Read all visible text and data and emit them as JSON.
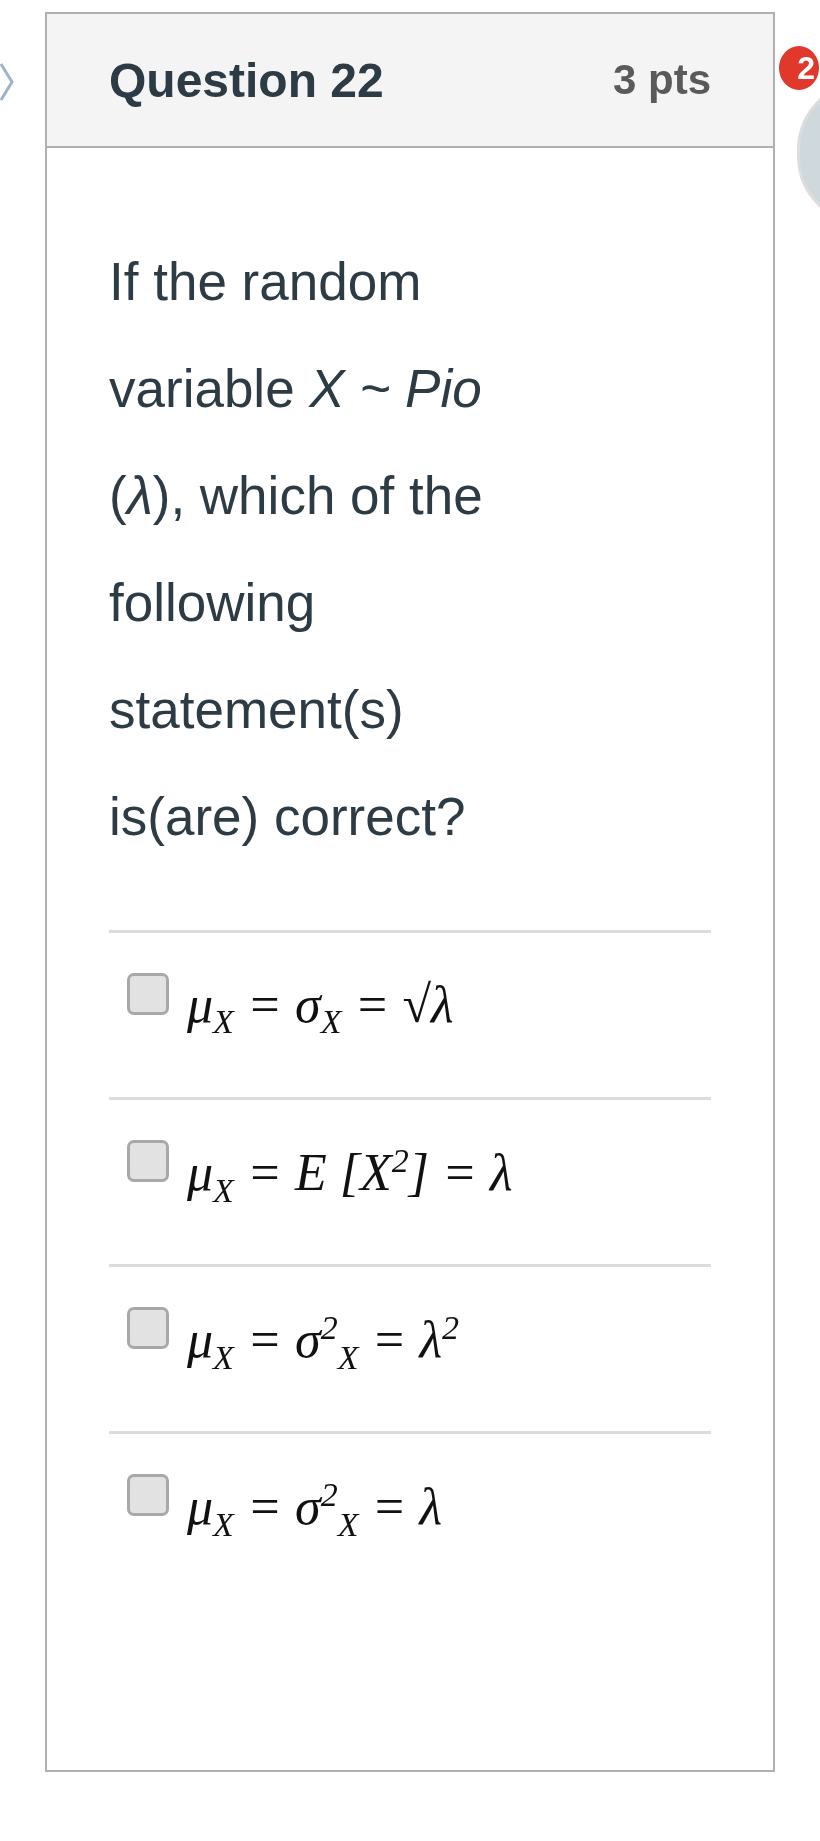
{
  "question": {
    "title": "Question 22",
    "points": "3 pts",
    "text": "If the random variable *X ~ Pio* (*λ*), which of the following statement(s) is(are) correct?"
  },
  "options": [
    {
      "formula": "μ$_{X}$ = σ$_{X}$ = √λ",
      "checked": false
    },
    {
      "formula": "μ$_{X}$ = E [X$^{2}$] = λ",
      "checked": false
    },
    {
      "formula": "μ$_{X}$ = σ$^{2}$$_{X}$ = λ$^{2}$",
      "checked": false
    },
    {
      "formula": "μ$_{X}$ = σ$^{2}$$_{X}$ = λ",
      "checked": false
    }
  ],
  "notification_badge": "2"
}
